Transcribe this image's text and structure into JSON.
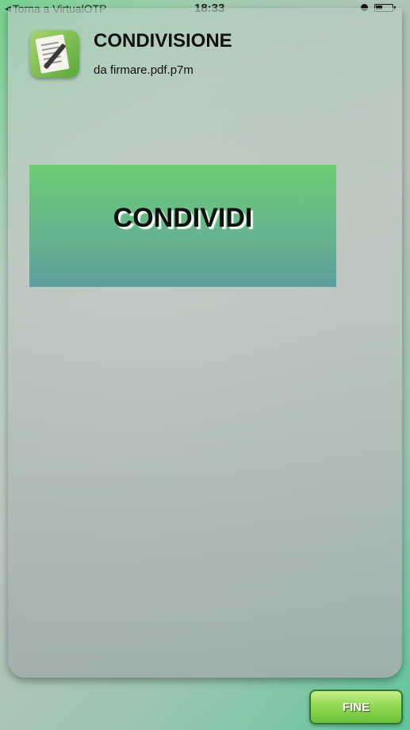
{
  "status_bar": {
    "back_label": "Torna a VirtualOTP",
    "time": "18:33"
  },
  "header": {
    "title": "CONDIVISIONE",
    "subtitle": "da firmare.pdf.p7m"
  },
  "main": {
    "share_label": "CONDIVIDI"
  },
  "footer": {
    "done_label": "FINE"
  },
  "colors": {
    "accent_green": "#6ccd74",
    "button_teal": "#5e9e9c"
  }
}
